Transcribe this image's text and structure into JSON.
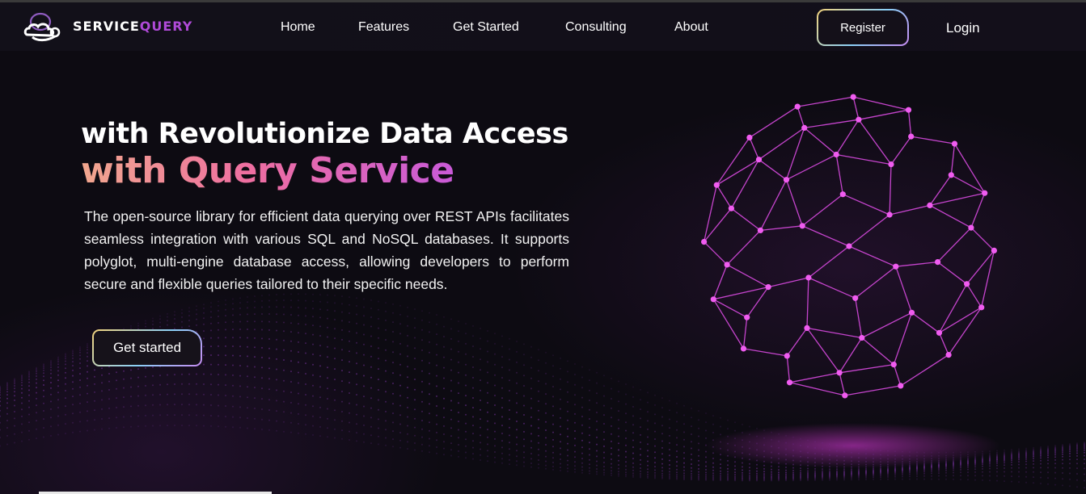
{
  "brand": {
    "part1": "SERVICE",
    "part2": "QUERY"
  },
  "nav": {
    "links": [
      "Home",
      "Features",
      "Get Started",
      "Consulting",
      "About"
    ],
    "register_label": "Register",
    "login_label": "Login"
  },
  "hero": {
    "line1": "with Revolutionize Data Access",
    "line2": "with Query Service",
    "description": "The open-source library for efficient data querying over REST APIs facilitates seamless integration with various SQL and NoSQL databases. It supports polyglot, multi-engine database access, allowing developers to perform secure and flexible queries tailored to their specific needs.",
    "cta_label": "Get started"
  },
  "colors": {
    "background": "#0d0b12",
    "nav_background": "#121019",
    "brand_accent": "#b04ad8",
    "globe": "#e040e8",
    "gradient_start": "#f1a78e",
    "gradient_end": "#c95ad8"
  },
  "icons": {
    "logo": "cloud-logo-icon",
    "hero_graphic": "network-globe-icon"
  }
}
